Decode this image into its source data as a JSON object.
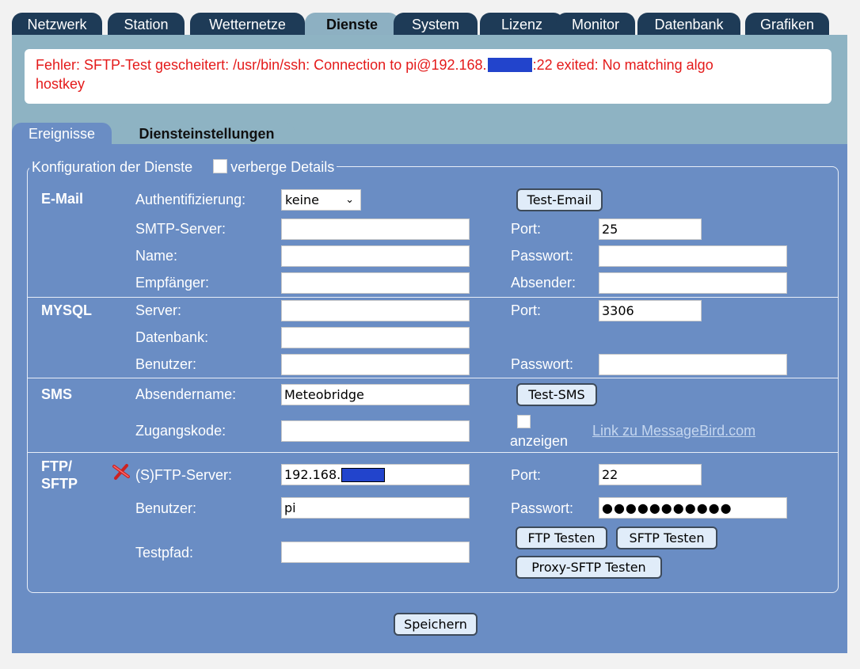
{
  "tabs": [
    "Netzwerk",
    "Station",
    "Wetternetze",
    "Dienste",
    "System",
    "Lizenz",
    "Monitor",
    "Datenbank",
    "Grafiken"
  ],
  "active_tab": "Dienste",
  "error": {
    "prefix": "Fehler: SFTP-Test gescheitert: /usr/bin/ssh: Connection to pi@192.168.",
    "suffix": ":22 exited: No matching algo",
    "line2": "hostkey"
  },
  "subtabs": [
    "Ereignisse",
    "Diensteinstellungen"
  ],
  "active_subtab": "Diensteinstellungen",
  "config": {
    "legend": "Konfiguration der Dienste",
    "hide_details_label": "verberge Details"
  },
  "email": {
    "section": "E-Mail",
    "auth_label": "Authentifizierung:",
    "auth_value": "keine",
    "test_button": "Test-Email",
    "smtp_label": "SMTP-Server:",
    "smtp_value": "",
    "port_label": "Port:",
    "port_value": "25",
    "name_label": "Name:",
    "name_value": "",
    "password_label": "Passwort:",
    "password_value": "",
    "recipient_label": "Empfänger:",
    "recipient_value": "",
    "sender_label": "Absender:",
    "sender_value": ""
  },
  "mysql": {
    "section": "MYSQL",
    "server_label": "Server:",
    "server_value": "",
    "port_label": "Port:",
    "port_value": "3306",
    "database_label": "Datenbank:",
    "database_value": "",
    "user_label": "Benutzer:",
    "user_value": "",
    "password_label": "Passwort:",
    "password_value": ""
  },
  "sms": {
    "section": "SMS",
    "sender_name_label": "Absendername:",
    "sender_name_value": "Meteobridge",
    "test_button": "Test-SMS",
    "access_code_label": "Zugangskode:",
    "access_code_value": "",
    "show_label": "anzeigen",
    "link_label": "Link zu MessageBird.com"
  },
  "ftp": {
    "section_line1": "FTP/",
    "section_line2": "SFTP",
    "server_label": "(S)FTP-Server:",
    "server_value": "192.168.",
    "port_label": "Port:",
    "port_value": "22",
    "user_label": "Benutzer:",
    "user_value": "pi",
    "password_label": "Passwort:",
    "password_value": "●●●●●●●●●●●",
    "testpath_label": "Testpfad:",
    "testpath_value": "",
    "ftp_test_button": "FTP Testen",
    "sftp_test_button": "SFTP Testen",
    "proxy_sftp_test_button": "Proxy-SFTP Testen"
  },
  "save_button": "Speichern"
}
